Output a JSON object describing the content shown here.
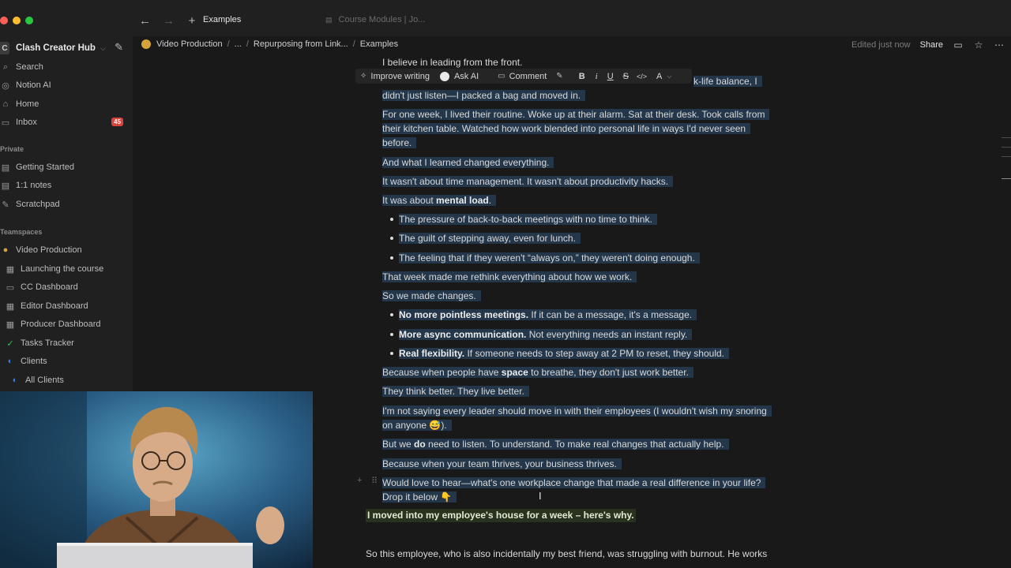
{
  "window": {
    "lights": [
      "#ff5f57",
      "#febc2e",
      "#28c840"
    ],
    "nav": {
      "back": "←",
      "forward": "→",
      "new": "+"
    },
    "tabs": [
      {
        "label": "Examples",
        "active": true
      },
      {
        "label": "Course Modules | Jo...",
        "active": false
      }
    ]
  },
  "sidebar": {
    "workspace": {
      "initial": "C",
      "name": "Clash Creator Hub",
      "chevron": "⌵",
      "edit_icon": "✎"
    },
    "top_items": [
      {
        "label": "Search",
        "icon": "⌕"
      },
      {
        "label": "Notion AI",
        "icon": "◎"
      },
      {
        "label": "Home",
        "icon": "⌂"
      },
      {
        "label": "Inbox",
        "icon": "▭",
        "badge": "45"
      }
    ],
    "private_label": "Private",
    "private_items": [
      {
        "label": "Getting Started",
        "icon": "▤"
      },
      {
        "label": "1:1 notes",
        "icon": "▤"
      },
      {
        "label": "Scratchpad",
        "icon": "✎"
      }
    ],
    "teamspaces_label": "Teamspaces",
    "team_items": [
      {
        "label": "Video Production",
        "icon": "●",
        "color": "#d6a23a"
      },
      {
        "label": "Launching the course",
        "icon": "▦"
      },
      {
        "label": "CC Dashboard",
        "icon": "▭"
      },
      {
        "label": "Editor Dashboard",
        "icon": "▦"
      },
      {
        "label": "Producer Dashboard",
        "icon": "▦"
      },
      {
        "label": "Tasks Tracker",
        "icon": "✓",
        "color": "#3fbf5a"
      },
      {
        "label": "Clients",
        "icon": "◐",
        "color": "#3a7bd5"
      },
      {
        "label": "All Clients",
        "icon": "◐",
        "color": "#3a7bd5"
      }
    ]
  },
  "header": {
    "breadcrumbs": [
      "Video Production",
      "...",
      "Repurposing from Link...",
      "Examples"
    ],
    "edited": "Edited just now",
    "share": "Share",
    "icons": [
      "comment-icon",
      "star-icon",
      "more-icon"
    ]
  },
  "toolbar": {
    "improve": "Improve writing",
    "ask_ai": "Ask AI",
    "comment": "Comment",
    "format": [
      "B",
      "i",
      "U",
      "S",
      "</>",
      "A"
    ]
  },
  "doc": {
    "lines": [
      {
        "text": "I believe in leading from the front."
      },
      {
        "text": "k-life balance, I"
      },
      {
        "text": "didn't just listen—I packed a bag and moved in."
      },
      {
        "text": "For one week, I lived their routine. Woke up at their alarm. Sat at their desk. Took calls from"
      },
      {
        "text": "their kitchen table. Watched how work blended into personal life in ways I'd never seen"
      },
      {
        "text": "before."
      },
      {
        "text": "And what I learned changed everything."
      },
      {
        "text": "It wasn't about time management. It wasn't about productivity hacks."
      },
      {
        "pre": "It was about ",
        "bold": "mental load",
        "post": "."
      },
      {
        "text": "The pressure of back-to-back meetings with no time to think.",
        "bullet": true
      },
      {
        "text": "The guilt of stepping away, even for lunch.",
        "bullet": true
      },
      {
        "text": "The feeling that if they weren't “always on,” they weren't doing enough.",
        "bullet": true
      },
      {
        "text": "That week made me rethink everything about how we work."
      },
      {
        "text": "So we made changes."
      },
      {
        "bold": "No more pointless meetings.",
        "post": " If it can be a message, it's a message.",
        "bullet": true
      },
      {
        "bold": "More async communication.",
        "post": " Not everything needs an instant reply.",
        "bullet": true
      },
      {
        "bold": "Real flexibility.",
        "post": " If someone needs to step away at 2 PM to reset, they should.",
        "bullet": true
      },
      {
        "pre": "Because when people have ",
        "bold": "space",
        "post": " to breathe, they don't just work better."
      },
      {
        "text": "They think better. They live better."
      },
      {
        "text": "I'm not saying every leader should move in with their employees (I wouldn't wish my snoring"
      },
      {
        "text": "on anyone 😅)."
      },
      {
        "pre": "But we ",
        "bold": "do",
        "post": " need to listen. To understand. To make real changes that actually help."
      },
      {
        "text": "Because when your team thrives, your business thrives."
      },
      {
        "text": "Would love to hear—what's one workplace change that made a real difference in your life?"
      },
      {
        "text": "Drop it below 👇"
      }
    ],
    "green_heading": "I moved into my employee's house for a week – here's why.",
    "paragraph": "So this employee, who is also incidentally my best friend, was struggling with burnout. He works"
  }
}
